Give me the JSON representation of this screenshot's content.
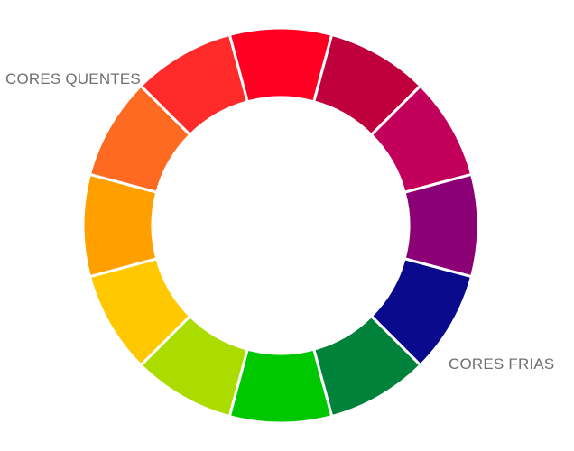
{
  "labels": {
    "warm": "CORES QUENTES",
    "cool": "CORES FRIAS"
  },
  "wheel": {
    "segments": [
      {
        "name": "red",
        "color": "#ff0022"
      },
      {
        "name": "crimson",
        "color": "#c0003c"
      },
      {
        "name": "magenta-red",
        "color": "#c2005b"
      },
      {
        "name": "purple",
        "color": "#8c0075"
      },
      {
        "name": "blue",
        "color": "#0a0a8c"
      },
      {
        "name": "dark-green",
        "color": "#00823a"
      },
      {
        "name": "green",
        "color": "#00c800"
      },
      {
        "name": "yellow-green",
        "color": "#aadc00"
      },
      {
        "name": "yellow",
        "color": "#ffc800"
      },
      {
        "name": "orange-yellow",
        "color": "#ffa000"
      },
      {
        "name": "orange",
        "color": "#ff6a22"
      },
      {
        "name": "red-orange",
        "color": "#ff2a2a"
      }
    ],
    "separator_color": "#ffffff",
    "background_color": "#ffffff"
  }
}
